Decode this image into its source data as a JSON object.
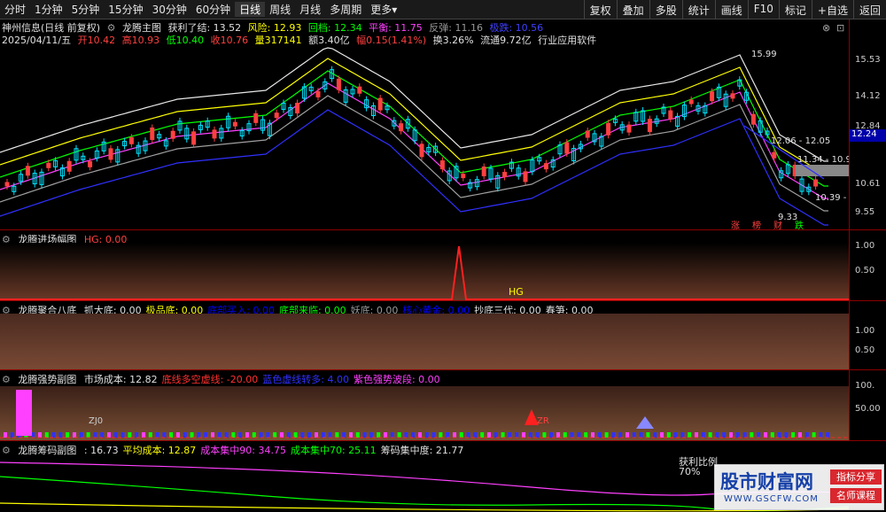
{
  "toolbar": {
    "periods": [
      "分时",
      "1分钟",
      "5分钟",
      "15分钟",
      "30分钟",
      "60分钟",
      "日线",
      "周线",
      "月线",
      "多周期",
      "更多"
    ],
    "right_buttons": [
      "复权",
      "叠加",
      "多股",
      "统计",
      "画线",
      "F10",
      "标记",
      "+自选",
      "返回"
    ]
  },
  "header": {
    "stock_name": "神州信息(日线 前复权)",
    "indicator_name": "龙腾主图",
    "profit_label": "获利了结: 13.52",
    "risk_label": "风险: 12.93",
    "pullback_label": "回档: 12.34",
    "balance_label": "平衡: 11.75",
    "rebound_label": "反弹: 11.16",
    "extreme_label": "极跌: 10.56",
    "date": "2025/04/11/五",
    "open": "开10.42",
    "high": "高10.93",
    "low": "低10.40",
    "close": "收10.76",
    "volume": "量317141",
    "amount": "额3.40亿",
    "amplitude": "幅0.15(1.41%)",
    "turnover": "换3.26%",
    "float": "流通9.72亿",
    "industry": "行业应用软件"
  },
  "main_chart": {
    "price_axis": [
      "15.53",
      "14.12",
      "12.84",
      "10.61",
      "9.55"
    ],
    "current_price": "12.24",
    "annotations": {
      "peak": "15.99",
      "range1": "12.06 - 12.05",
      "range2": "11.34 - 10.9",
      "last": "10.39 -",
      "low": "9.33"
    },
    "signals": [
      "涨",
      "榜",
      "财",
      "跌"
    ]
  },
  "panel1": {
    "name": "龙腾进场幅图",
    "value": "HG: 0.00",
    "marker": "HG",
    "axis": [
      "1.00",
      "0.50"
    ]
  },
  "panel2": {
    "name": "龙腾聚合八底",
    "items": [
      {
        "label": "抓大底: 0.00",
        "color": "#e0e0e0"
      },
      {
        "label": "极品底: 0.00",
        "color": "#ffff00"
      },
      {
        "label": "底部买入: 0.00",
        "color": "#0000ff"
      },
      {
        "label": "底部来临: 0.00",
        "color": "#00ff00"
      },
      {
        "label": "妖底: 0.00",
        "color": "#999999"
      },
      {
        "label": "核心黄金: 0.00",
        "color": "#0000ff"
      },
      {
        "label": "抄底三代: 0.00",
        "color": "#e0e0e0"
      },
      {
        "label": "春笋: 0.00",
        "color": "#e0e0e0"
      }
    ],
    "axis": [
      "1.00",
      "0.50"
    ]
  },
  "panel3": {
    "name": "龙腾强势副图",
    "items": [
      {
        "label": "市场成本: 12.82",
        "color": "#e0e0e0"
      },
      {
        "label": "底线多空虚线: -20.00",
        "color": "#ff3030"
      },
      {
        "label": "蓝色虚线转多: 4.00",
        "color": "#3030ff"
      },
      {
        "label": "紫色强势波段: 0.00",
        "color": "#ff40ff"
      }
    ],
    "axis": [
      "100.",
      "50.00"
    ],
    "tags": [
      "ZJ0",
      "ZR"
    ]
  },
  "panel4": {
    "name": "龙腾筹码副图",
    "items": [
      {
        "label": ": 16.73",
        "color": "#e0e0e0"
      },
      {
        "label": "平均成本: 12.87",
        "color": "#ffff00"
      },
      {
        "label": "成本集中90: 34.75",
        "color": "#ff40ff"
      },
      {
        "label": "成本集中70: 25.11",
        "color": "#00ff00"
      },
      {
        "label": "筹码集中度: 21.77",
        "color": "#e0e0e0"
      }
    ],
    "overlay": [
      "获利比例",
      "70%"
    ]
  },
  "watermark": {
    "title": "股市财富网",
    "url": "WWW.GSCFW.COM",
    "tag1": "指标分享",
    "tag2": "名师课程"
  }
}
